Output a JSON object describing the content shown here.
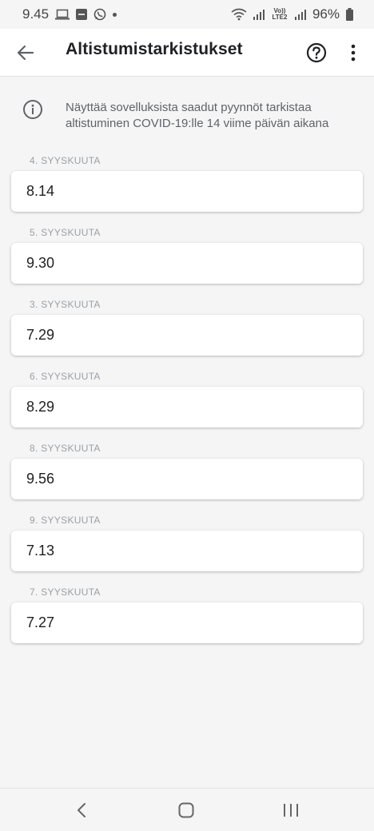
{
  "status_bar": {
    "time": "9.45",
    "network": "Vo)) LTE2",
    "battery": "96%"
  },
  "app_bar": {
    "title": "Altistumistarkistukset"
  },
  "info": {
    "text": "Näyttää sovelluksista saadut pyynnöt tarkistaa altistuminen COVID-19:lle 14 viime päivän aikana"
  },
  "checks": [
    {
      "date": "4. SYYSKUUTA",
      "time": "8.14"
    },
    {
      "date": "5. SYYSKUUTA",
      "time": "9.30"
    },
    {
      "date": "3. SYYSKUUTA",
      "time": "7.29"
    },
    {
      "date": "6. SYYSKUUTA",
      "time": "8.29"
    },
    {
      "date": "8. SYYSKUUTA",
      "time": "9.56"
    },
    {
      "date": "9. SYYSKUUTA",
      "time": "7.13"
    },
    {
      "date": "7. SYYSKUUTA",
      "time": "7.27"
    }
  ],
  "icons": {
    "back": "arrow-left",
    "help": "help-circle",
    "more": "more-vertical",
    "info": "info-circle"
  }
}
